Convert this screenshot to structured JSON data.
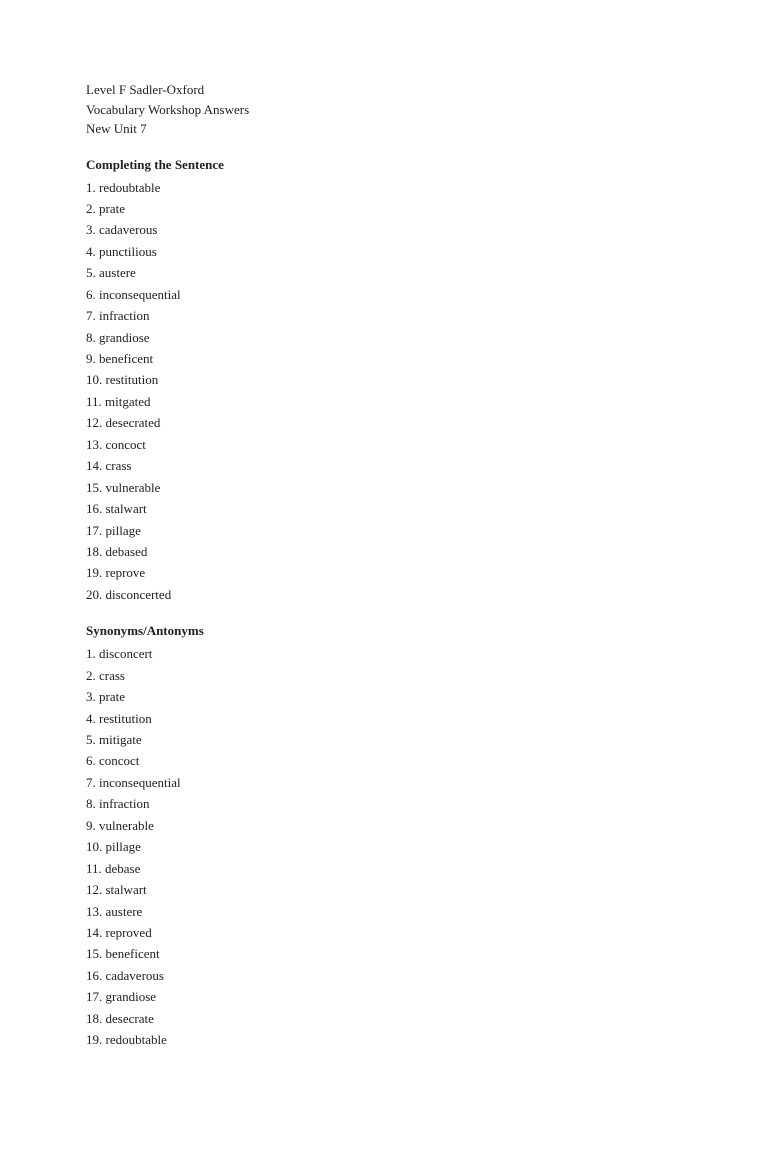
{
  "header": {
    "line1": "Level F Sadler-Oxford",
    "line2": "Vocabulary Workshop Answers",
    "line3": "New Unit 7"
  },
  "completing_section": {
    "title": "Completing the Sentence",
    "items": [
      "1. redoubtable",
      "2. prate",
      "3. cadaverous",
      "4. punctilious",
      "5. austere",
      "6. inconsequential",
      "7. infraction",
      "8. grandiose",
      "9. beneficent",
      "10. restitution",
      "11. mitgated",
      "12. desecrated",
      "13. concoct",
      "14. crass",
      "15. vulnerable",
      "16. stalwart",
      "17. pillage",
      "18. debased",
      "19. reprove",
      "20. disconcerted"
    ]
  },
  "synonyms_section": {
    "title": "Synonyms/Antonyms",
    "items": [
      "1. disconcert",
      "2. crass",
      "3. prate",
      "4. restitution",
      "5. mitigate",
      "6. concoct",
      "7. inconsequential",
      "8. infraction",
      "9. vulnerable",
      "10. pillage",
      "11. debase",
      "12. stalwart",
      "13. austere",
      "14. reproved",
      "15. beneficent",
      "16. cadaverous",
      "17. grandiose",
      "18. desecrate",
      "19. redoubtable"
    ]
  }
}
